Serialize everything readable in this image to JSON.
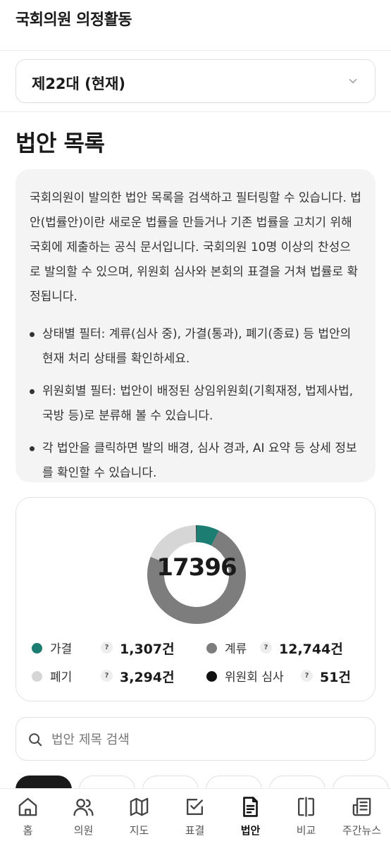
{
  "header": {
    "title": "국회의원 의정활동"
  },
  "term_select": {
    "value": "제22대 (현재)"
  },
  "page": {
    "title": "법안 목록"
  },
  "info": {
    "description": "국회의원이 발의한 법안 목록을 검색하고 필터링할 수 있습니다. 법안(법률안)이란 새로운 법률을 만들거나 기존 법률을 고치기 위해 국회에 제출하는 공식 문서입니다. 국회의원 10명 이상의 찬성으로 발의할 수 있으며, 위원회 심사와 본회의 표결을 거쳐 법률로 확정됩니다.",
    "bullets": [
      "상태별 필터: 계류(심사 중), 가결(통과), 폐기(종료) 등 법안의 현재 처리 상태를 확인하세요.",
      "위원회별 필터: 법안이 배정된 상임위원회(기획재정, 법제사법, 국방 등)로 분류해 볼 수 있습니다.",
      "각 법안을 클릭하면 발의 배경, 심사 경과, AI 요약 등 상세 정보를 확인할 수 있습니다."
    ]
  },
  "chart_data": {
    "type": "pie",
    "style": "donut",
    "total": "17396",
    "categories": [
      "가결",
      "계류",
      "폐기",
      "위원회 심사"
    ],
    "values": [
      1307,
      12744,
      3294,
      51
    ],
    "colors": [
      "#1c7d73",
      "#7d7d7d",
      "#d6d6d6",
      "#111111"
    ],
    "counts": [
      "1,307건",
      "12,744건",
      "3,294건",
      "51건"
    ],
    "help_glyph": "?"
  },
  "search": {
    "placeholder": "법안 제목 검색",
    "value": ""
  },
  "nav": {
    "items": [
      {
        "label": "홈",
        "icon": "home-icon"
      },
      {
        "label": "의원",
        "icon": "users-icon"
      },
      {
        "label": "지도",
        "icon": "map-icon"
      },
      {
        "label": "표결",
        "icon": "vote-check-icon"
      },
      {
        "label": "법안",
        "icon": "document-icon",
        "active": true
      },
      {
        "label": "비교",
        "icon": "compare-icon"
      },
      {
        "label": "주간뉴스",
        "icon": "newspaper-icon"
      }
    ]
  }
}
